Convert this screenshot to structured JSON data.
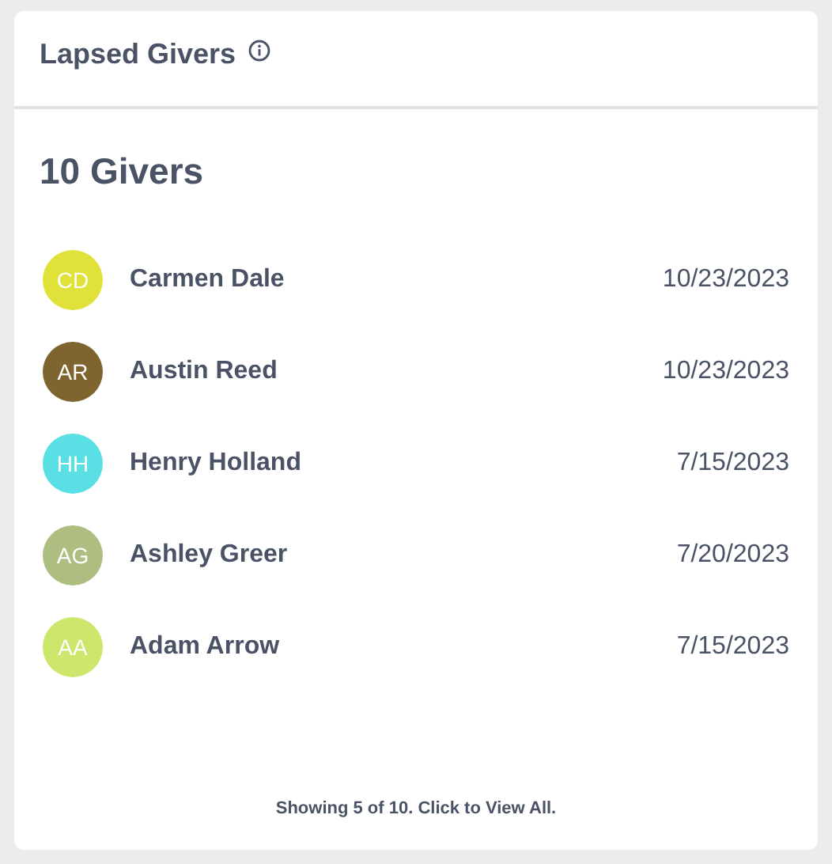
{
  "card": {
    "title": "Lapsed Givers",
    "count_label": "10 Givers",
    "givers": [
      {
        "initials": "CD",
        "name": "Carmen Dale",
        "date": "10/23/2023",
        "color": "#e0e23a"
      },
      {
        "initials": "AR",
        "name": "Austin Reed",
        "date": "10/23/2023",
        "color": "#7e6530"
      },
      {
        "initials": "HH",
        "name": "Henry Holland",
        "date": "7/15/2023",
        "color": "#5ae0e4"
      },
      {
        "initials": "AG",
        "name": "Ashley Greer",
        "date": "7/20/2023",
        "color": "#adbe80"
      },
      {
        "initials": "AA",
        "name": "Adam Arrow",
        "date": "7/15/2023",
        "color": "#cde66c"
      }
    ],
    "footer": "Showing 5 of 10. Click to View All."
  }
}
